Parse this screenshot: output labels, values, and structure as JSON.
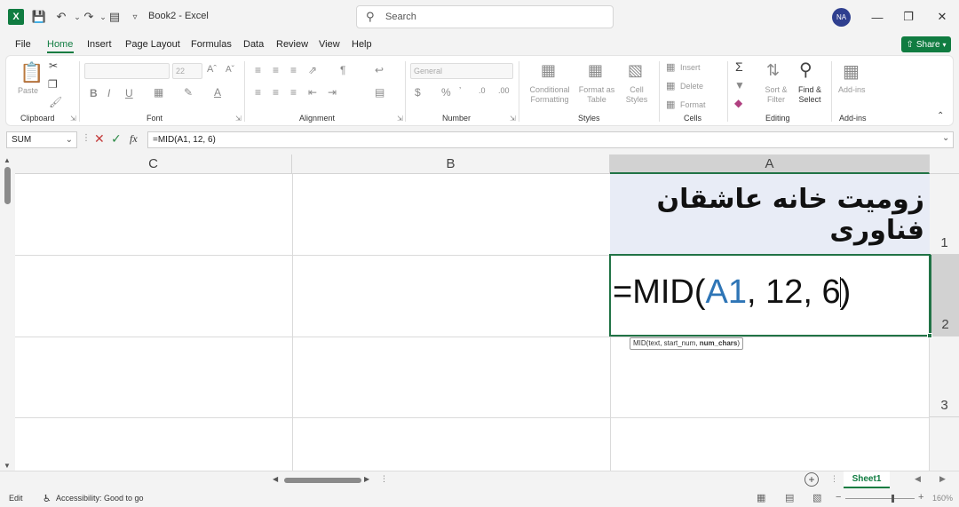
{
  "titlebar": {
    "doc_title": "Book2  -  Excel",
    "search_placeholder": "Search",
    "avatar_initials": "NA",
    "app_icon": "X"
  },
  "menu": {
    "tabs": [
      "File",
      "Home",
      "Insert",
      "Page Layout",
      "Formulas",
      "Data",
      "Review",
      "View",
      "Help"
    ],
    "share_label": "Share"
  },
  "ribbon": {
    "clipboard": {
      "paste": "Paste",
      "label": "Clipboard"
    },
    "font": {
      "font_name": "",
      "font_size": "22",
      "label": "Font"
    },
    "alignment": {
      "label": "Alignment"
    },
    "number": {
      "format": "General",
      "label": "Number"
    },
    "styles": {
      "conditional": [
        "Conditional",
        "Formatting"
      ],
      "format_as": [
        "Format as",
        "Table"
      ],
      "cell_styles": [
        "Cell",
        "Styles"
      ],
      "label": "Styles"
    },
    "cells": {
      "insert": "Insert",
      "delete": "Delete",
      "format": "Format",
      "label": "Cells"
    },
    "editing": {
      "sort": [
        "Sort &",
        "Filter"
      ],
      "find": [
        "Find &",
        "Select"
      ],
      "label": "Editing"
    },
    "addins": {
      "addins": "Add-ins",
      "label": "Add-ins"
    }
  },
  "formula_bar": {
    "name_box": "SUM",
    "formula": "=MID(A1, 12, 6)"
  },
  "grid": {
    "columns": [
      "C",
      "B",
      "A"
    ],
    "rows": [
      "1",
      "2",
      "3"
    ],
    "cell_a1": "زومیت خانه عاشقان فناوری",
    "cell_a2": {
      "prefix": "=MID(",
      "ref": "A1",
      "args": ", 12, 6",
      "close": ")"
    },
    "tooltip": {
      "head": "MID(text, start_num, ",
      "bold": "num_chars",
      "tail": ")"
    }
  },
  "sheets": {
    "active": "Sheet1"
  },
  "status": {
    "mode": "Edit",
    "accessibility": "Accessibility: Good to go",
    "zoom": "160%"
  }
}
